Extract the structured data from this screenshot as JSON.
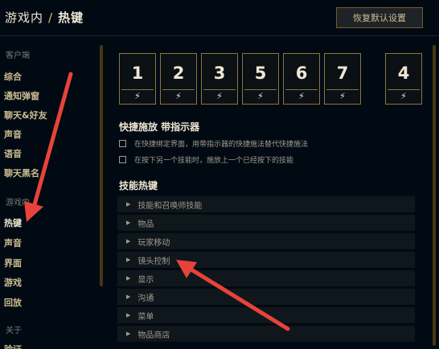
{
  "header": {
    "breadcrumb_section": "游戏内",
    "breadcrumb_separator": "/",
    "breadcrumb_current": "热键",
    "reset_button": "恢复默认设置"
  },
  "sidebar": {
    "client_section": "客户端",
    "client_items": [
      "综合",
      "通知弹窗",
      "聊天&好友",
      "声音",
      "语音",
      "聊天黑名"
    ],
    "ingame_section": "游戏内",
    "ingame_items": [
      "热键",
      "声音",
      "界面",
      "游戏",
      "回放"
    ],
    "about_section": "关于",
    "about_items": [
      "验证"
    ]
  },
  "key_cards": [
    {
      "label": "1",
      "icon": "lightning-bolt-icon"
    },
    {
      "label": "2",
      "icon": "lightning-bolt-icon"
    },
    {
      "label": "3",
      "icon": "lightning-bolt-icon"
    },
    {
      "label": "5",
      "icon": "lightning-bolt-icon"
    },
    {
      "label": "6",
      "icon": "lightning-bolt-icon"
    },
    {
      "label": "7",
      "icon": "lightning-bolt-icon"
    },
    {
      "label": "4",
      "icon": "lightning-bolt-icon"
    }
  ],
  "quickcast": {
    "title": "快捷施放 带指示器",
    "options": [
      {
        "label": "在快捷绑定界面，用带指示器的快捷施法替代快捷施法",
        "checked": false
      },
      {
        "label": "在按下另一个技能时，施放上一个已经按下的技能",
        "checked": false
      }
    ]
  },
  "ability_hotkeys": {
    "title": "技能热键",
    "categories": [
      "技能和召唤师技能",
      "物品",
      "玩家移动",
      "镜头控制",
      "显示",
      "沟通",
      "菜单",
      "物品商店"
    ]
  },
  "colors": {
    "background": "#010a13",
    "gold": "#cdbe91",
    "gold_dark": "#785a28",
    "arrow_red": "#e8433a"
  }
}
